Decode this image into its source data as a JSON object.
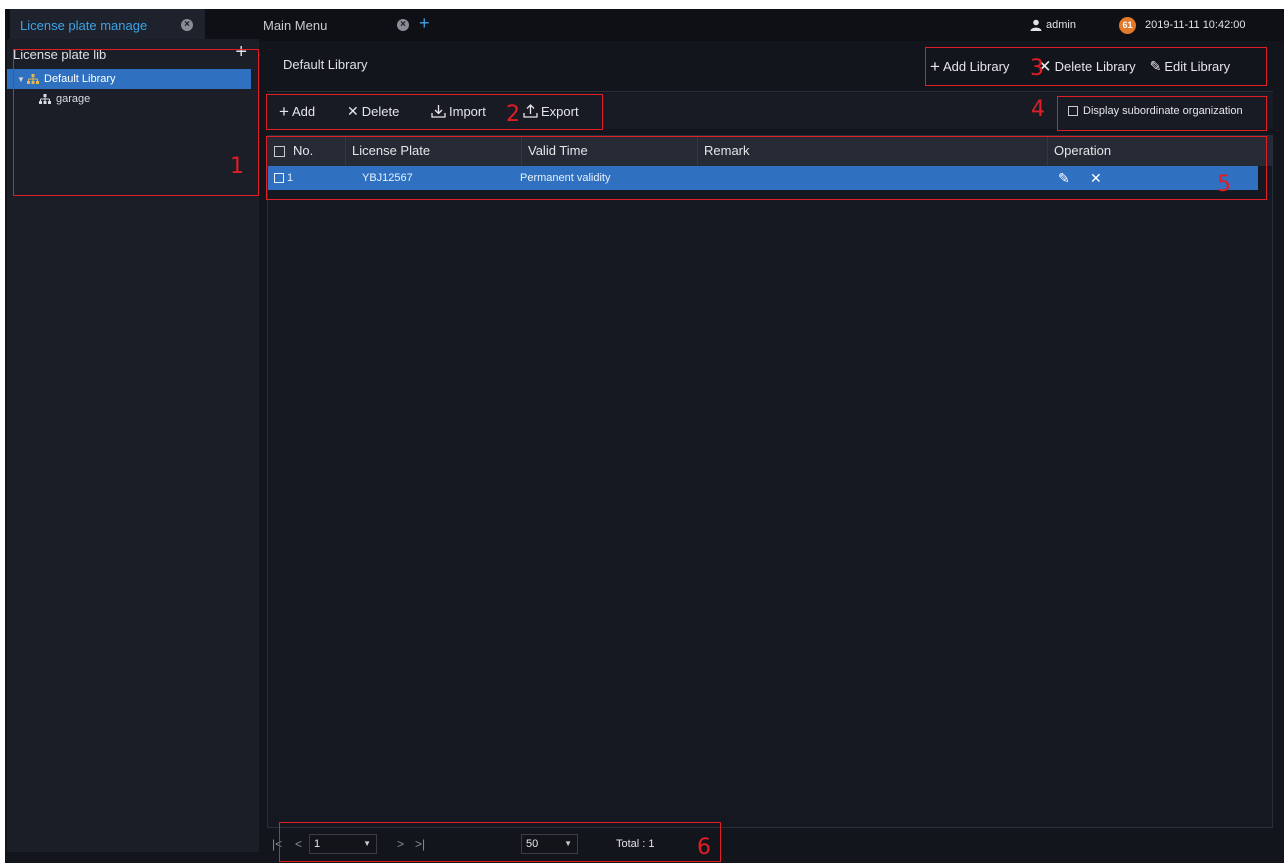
{
  "tabs": [
    {
      "label": "License plate manage"
    },
    {
      "label": "Main Menu"
    }
  ],
  "topbar": {
    "user": "admin",
    "badge": "61",
    "datetime": "2019-11-11 10:42:00"
  },
  "sidebar": {
    "title": "License plate lib",
    "tree": [
      {
        "label": "Default Library",
        "selected": true
      },
      {
        "label": "garage"
      }
    ]
  },
  "content": {
    "title": "Default Library",
    "lib_actions": {
      "add": "Add Library",
      "delete": "Delete Library",
      "edit": "Edit Library"
    },
    "toolbar": {
      "add": "Add",
      "delete": "Delete",
      "import": "Import",
      "export": "Export"
    },
    "subordinate_label": "Display subordinate organization"
  },
  "table": {
    "columns": [
      "No.",
      "License Plate",
      "Valid Time",
      "Remark",
      "Operation"
    ],
    "rows": [
      {
        "no": "1",
        "plate": "YBJ12567",
        "valid": "Permanent validity",
        "remark": ""
      }
    ]
  },
  "pagination": {
    "page": "1",
    "page_size": "50",
    "total": "Total : 1"
  },
  "callouts": [
    "1",
    "2",
    "3",
    "4",
    "5",
    "6"
  ],
  "colors": {
    "accent": "#2f71c0",
    "tab_text": "#3ca3e6",
    "callout": "#e11d25",
    "badge": "#e27a2a"
  }
}
